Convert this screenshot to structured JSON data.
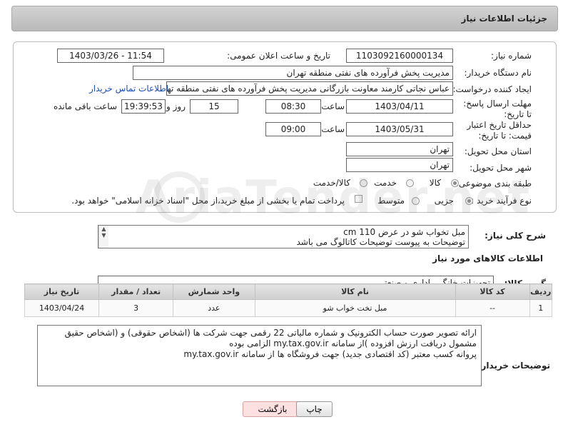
{
  "header": {
    "title": "جزئیات اطلاعات نیاز"
  },
  "form": {
    "need_number_label": "شماره نیاز:",
    "need_number": "1103092160000134",
    "announce_label": "تاریخ و ساعت اعلان عمومی:",
    "announce_value": "1403/03/26 - 11:54",
    "buyer_org_label": "نام دستگاه خریدار:",
    "buyer_org": "مدیریت پخش فرآورده های نفتی منطقه تهران",
    "requester_label": "ایجاد کننده درخواست:",
    "requester": "عباس نجاتی کارمند معاونت بازرگانی مدیریت پخش فرآورده های نفتی منطقه تهران",
    "contact_link": "اطلاعات تماس خریدار",
    "deadline_label": "مهلت ارسال پاسخ: تا تاریخ:",
    "deadline_date": "1403/04/11",
    "time_label": "ساعت",
    "deadline_time": "08:30",
    "days_value": "15",
    "days_label": "روز و",
    "remaining_time": "19:39:53",
    "remaining_label": "ساعت باقی مانده",
    "validity_label": "حداقل تاریخ اعتبار قیمت: تا تاریخ:",
    "validity_date": "1403/05/31",
    "validity_time_label": "ساعت",
    "validity_time": "09:00",
    "province_label": "استان محل تحویل:",
    "province": "تهران",
    "city_label": "شهر محل تحویل:",
    "city": "تهران",
    "category_label": "طبقه بندی موضوعی:",
    "category_options": [
      "کالا",
      "خدمت",
      "کالا/خدمت"
    ],
    "process_label": "نوع فرآیند خرید :",
    "process_options": [
      "جزیی",
      "متوسط"
    ],
    "payment_note": "پرداخت تمام یا بخشی از مبلغ خرید،از محل \"اسناد خزانه اسلامی\" خواهد بود."
  },
  "description": {
    "label": "شرح کلی نیاز:",
    "line1": "مبل تخواب شو در عرض 110 cm",
    "line2": "توضیحات به پیوست توضیحات کاتالوگ می باشد"
  },
  "goods": {
    "section_title": "اطلاعات کالاهای مورد نیاز",
    "group_label": "گروه کالا:",
    "group_value": "تجهیزات خانگی، اداری و صنعتی",
    "columns": [
      "ردیف",
      "کد کالا",
      "نام کالا",
      "واحد شمارش",
      "تعداد / مقدار",
      "تاریخ نیاز"
    ],
    "rows": [
      {
        "row": "1",
        "code": "--",
        "name": "مبل تخت خواب شو",
        "unit": "عدد",
        "qty": "3",
        "date": "1403/04/24"
      }
    ]
  },
  "buyer_notes": {
    "label": "توضیحات خریدار:",
    "line1": "ارائه  تصویر صورت حساب الکترونیک و شماره مالیاتی 22 رقمی  جهت شرکت ها (اشخاص حقوقی) و (اشخاص حقیق",
    "line2": "مشمول دریافت ارزش افزوده )از سامانه my.tax.gov.ir  الزامی بوده",
    "line3": "پروانه کسب معتبر (کد اقتصادی جدید) جهت فروشگاه ها از سامانه my.tax.gov.ir"
  },
  "buttons": {
    "print": "چاپ",
    "back": "بازگشت"
  },
  "watermark": "AriaTender.net"
}
